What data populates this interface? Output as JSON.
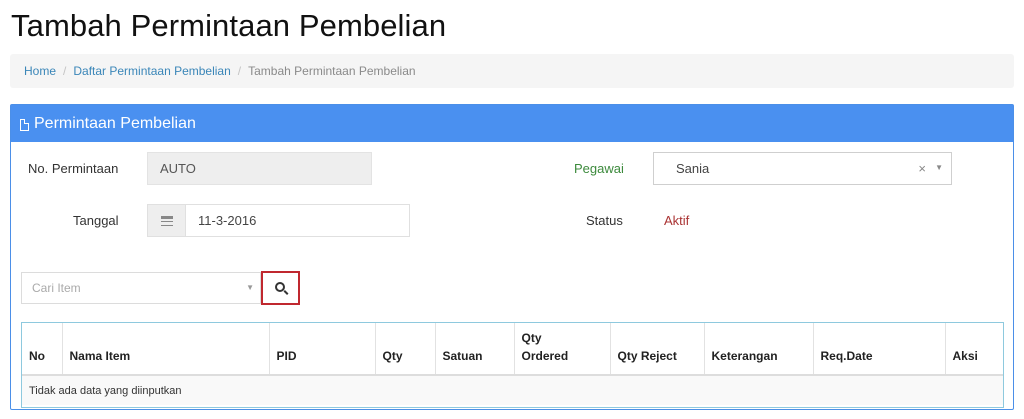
{
  "page_title": "Tambah Permintaan Pembelian",
  "breadcrumb": [
    "Home",
    "Daftar Permintaan Pembelian",
    "Tambah Permintaan Pembelian"
  ],
  "panel": {
    "title": "Permintaan Pembelian",
    "icon": "document-icon",
    "header_color": "#4a90f0"
  },
  "form": {
    "no_permintaan_label": "No. Permintaan",
    "no_permintaan_value": "AUTO",
    "tanggal_label": "Tanggal",
    "tanggal_value": "11-3-2016",
    "pegawai_label": "Pegawai",
    "pegawai_value": "Sania",
    "status_label": "Status",
    "status_value": "Aktif"
  },
  "search": {
    "placeholder": "Cari Item",
    "button_icon": "search-icon"
  },
  "table": {
    "columns": [
      "No",
      "Nama Item",
      "PID",
      "Qty",
      "Satuan",
      "Qty Ordered",
      "Qty Reject",
      "Keterangan",
      "Req.Date",
      "Aksi"
    ],
    "empty_message": "Tidak ada data yang diinputkan"
  }
}
